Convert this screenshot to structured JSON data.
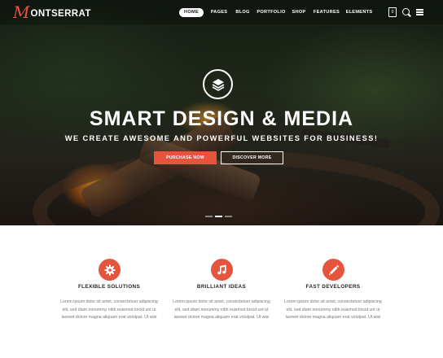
{
  "brand": {
    "logo_initial": "M",
    "logo_rest": "ONTSERRAT",
    "accent_color": "#e5553d"
  },
  "nav": {
    "items": [
      {
        "label": "HOME",
        "active": true
      },
      {
        "label": "PAGES",
        "active": false
      },
      {
        "label": "BLOG",
        "active": false
      },
      {
        "label": "PORTFOLIO",
        "active": false
      },
      {
        "label": "SHOP",
        "active": false
      },
      {
        "label": "FEATURES",
        "active": false
      },
      {
        "label": "ELEMENTS",
        "active": false
      }
    ],
    "cart_icon": "shopping-bag-icon",
    "cart_count": "0",
    "search_icon": "search-icon",
    "menu_icon": "hamburger-menu-icon"
  },
  "hero": {
    "icon": "layers-icon",
    "title": "SMART DESIGN & MEDIA",
    "subtitle": "WE CREATE AWESOME AND POWERFUL WEBSITES FOR BUSINESS!",
    "primary_button": "PURCHASE NOW",
    "secondary_button": "DISCOVER MORE",
    "slide_count": 3,
    "active_slide": 1
  },
  "features": [
    {
      "icon": "gear-icon",
      "title": "FLEXIBLE SOLUTIONS",
      "lines": [
        "Lorem ipsum dolor sit amet, consectetuer adipiscing",
        "elit, sed diam nonummy nibh euismod tincid unt ut",
        "laoreet dolore magna aliquam erat volutpat. Ut wisi"
      ]
    },
    {
      "icon": "music-note-icon",
      "title": "BRILLIANT IDEAS",
      "lines": [
        "Lorem ipsum dolor sit amet, consectetuer adipiscing",
        "elit, sed diam nonummy nibh euismod tincid unt ut",
        "laoreet dolore magna aliquam erat volutpat. Ut wisi"
      ]
    },
    {
      "icon": "pencil-icon",
      "title": "FAST DEVELOPERS",
      "lines": [
        "Lorem ipsum dolor sit amet, consectetuer adipiscing",
        "elit, sed diam nonummy nibh euismod tincid unt ut",
        "laoreet dolore magna aliquam erat volutpat. Ut wisi"
      ]
    }
  ]
}
